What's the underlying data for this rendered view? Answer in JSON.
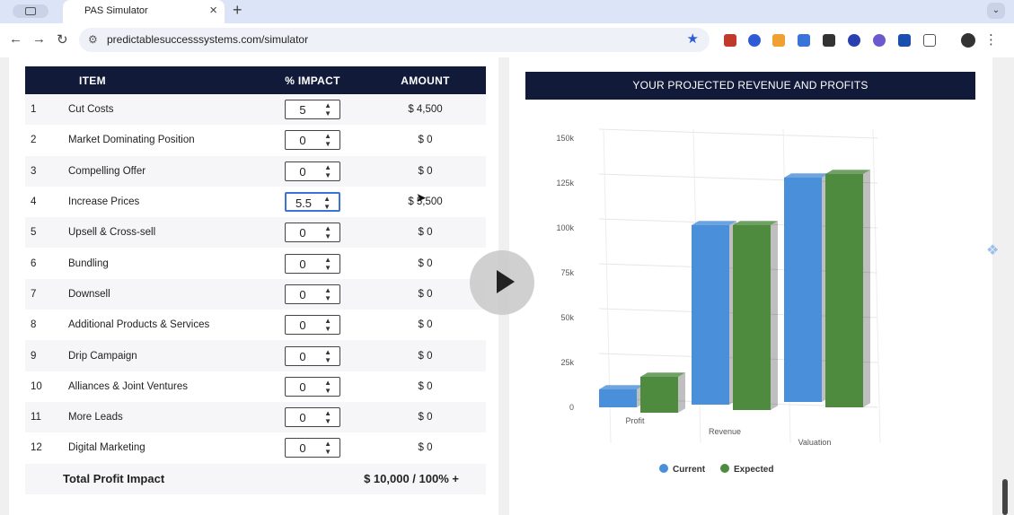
{
  "browser": {
    "tab_title": "PAS Simulator",
    "url": "predictablesuccesssystems.com/simulator"
  },
  "table": {
    "headers": [
      "ITEM",
      "% IMPACT",
      "AMOUNT"
    ],
    "rows": [
      {
        "num": "1",
        "item": "Cut Costs",
        "impact": "5",
        "amount": "$ 4,500"
      },
      {
        "num": "2",
        "item": "Market Dominating Position",
        "impact": "0",
        "amount": "$ 0"
      },
      {
        "num": "3",
        "item": "Compelling Offer",
        "impact": "0",
        "amount": "$ 0"
      },
      {
        "num": "4",
        "item": "Increase Prices",
        "impact": "5.5",
        "amount": "$ 5,500"
      },
      {
        "num": "5",
        "item": "Upsell & Cross-sell",
        "impact": "0",
        "amount": "$ 0"
      },
      {
        "num": "6",
        "item": "Bundling",
        "impact": "0",
        "amount": "$ 0"
      },
      {
        "num": "7",
        "item": "Downsell",
        "impact": "0",
        "amount": "$ 0"
      },
      {
        "num": "8",
        "item": "Additional Products & Services",
        "impact": "0",
        "amount": "$ 0"
      },
      {
        "num": "9",
        "item": "Drip Campaign",
        "impact": "0",
        "amount": "$ 0"
      },
      {
        "num": "10",
        "item": "Alliances & Joint Ventures",
        "impact": "0",
        "amount": "$ 0"
      },
      {
        "num": "11",
        "item": "More Leads",
        "impact": "0",
        "amount": "$ 0"
      },
      {
        "num": "12",
        "item": "Digital Marketing",
        "impact": "0",
        "amount": "$ 0"
      }
    ],
    "total_label": "Total Profit Impact",
    "total_value": "$ 10,000  /  100% +"
  },
  "chart_header": "YOUR PROJECTED REVENUE AND PROFITS",
  "chart_data": {
    "type": "bar",
    "categories": [
      "Profit",
      "Revenue",
      "Valuation"
    ],
    "series": [
      {
        "name": "Current",
        "values": [
          10000,
          100000,
          125000
        ],
        "color": "#4a8fd9"
      },
      {
        "name": "Expected",
        "values": [
          20000,
          103000,
          130000
        ],
        "color": "#4e8b3f"
      }
    ],
    "yticks": [
      "0",
      "25k",
      "50k",
      "75k",
      "100k",
      "125k",
      "150k"
    ],
    "ylim": [
      0,
      150000
    ],
    "legend": "bottom"
  }
}
